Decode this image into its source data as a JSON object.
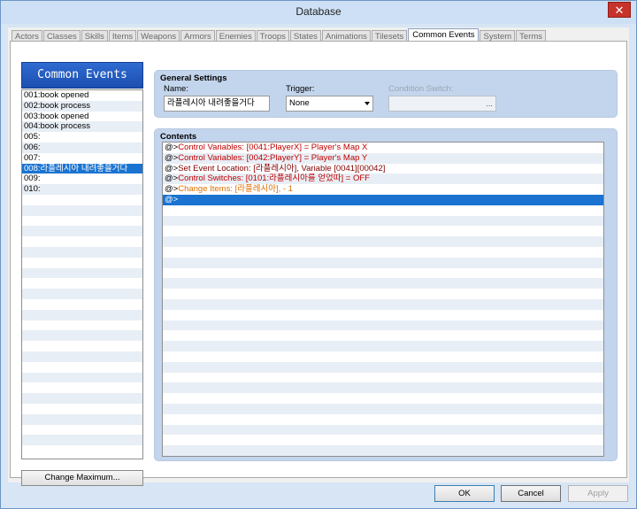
{
  "window": {
    "title": "Database",
    "close_symbol": "✕"
  },
  "tabs": [
    "Actors",
    "Classes",
    "Skills",
    "Items",
    "Weapons",
    "Armors",
    "Enemies",
    "Troops",
    "States",
    "Animations",
    "Tilesets",
    "Common Events",
    "System",
    "Terms"
  ],
  "active_tab": "Common Events",
  "left_pane": {
    "header": "Common Events",
    "items": [
      "001:book opened",
      "002:book process",
      "003:book opened",
      "004:book process",
      "005:",
      "006:",
      "007:",
      "008:라플레시아 내려좋을거다",
      "009:",
      "010:"
    ],
    "selected_index": 7,
    "change_max_label": "Change Maximum..."
  },
  "general_settings": {
    "title": "General Settings",
    "name_label": "Name:",
    "name_value": "라플레시아 내려좋을거다",
    "trigger_label": "Trigger:",
    "trigger_value": "None",
    "condition_label": "Condition Switch:",
    "condition_button": "..."
  },
  "contents": {
    "title": "Contents",
    "commands": [
      {
        "prefix": "@>",
        "text": "Control Variables: [0041:PlayerX] = Player's Map X",
        "color": "#c00000"
      },
      {
        "prefix": "@>",
        "text": "Control Variables: [0042:PlayerY] = Player's Map Y",
        "color": "#c00000"
      },
      {
        "prefix": "@>",
        "text": "Set Event Location: [라플레시아], Variable [0041][00042]",
        "color": "#800000"
      },
      {
        "prefix": "@>",
        "text": "Control Switches: [0101:라플레시아를 얻었따] = OFF",
        "color": "#c00000"
      },
      {
        "prefix": "@>",
        "text": "Change Items: [라플레시아], - 1",
        "color": "#e07000"
      },
      {
        "prefix": "@>",
        "text": "",
        "color": "#ffffff"
      }
    ],
    "selected_index": 5
  },
  "buttons": {
    "ok": "OK",
    "cancel": "Cancel",
    "apply": "Apply"
  }
}
